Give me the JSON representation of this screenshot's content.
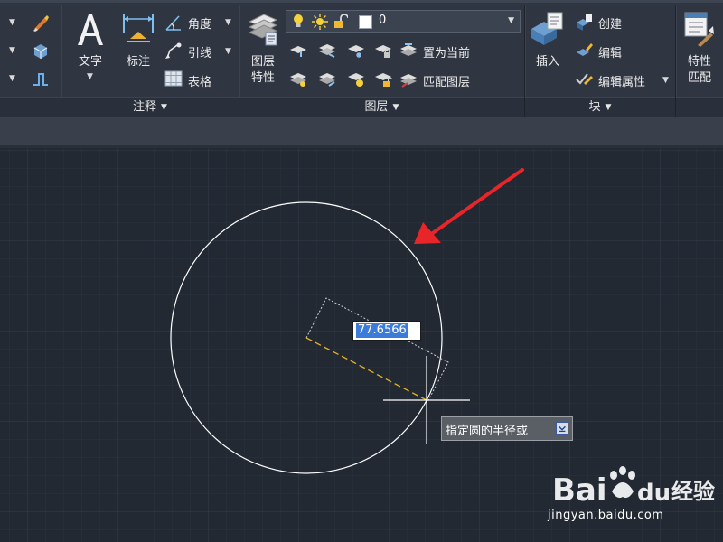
{
  "ribbon": {
    "annotation": {
      "text_label": "文字",
      "dimension_label": "标注",
      "angular_label": "角度",
      "leader_label": "引线",
      "table_label": "表格",
      "panel_title": "注释"
    },
    "layers": {
      "properties_label_line1": "图层",
      "properties_label_line2": "特性",
      "current_layer": "0",
      "set_current_label": "置为当前",
      "match_layer_label": "匹配图层",
      "panel_title": "图层"
    },
    "block": {
      "insert_label": "插入",
      "create_label": "创建",
      "edit_label": "编辑",
      "edit_attributes_label": "编辑属性",
      "panel_title": "块"
    },
    "properties": {
      "match_label_line1": "特性",
      "match_label_line2": "匹配"
    }
  },
  "drawing": {
    "dimension_value": "77.6566",
    "prompt_text": "指定圆的半径或"
  },
  "watermark": {
    "brand": "Bai",
    "brand_tail": "du",
    "product": "经验",
    "url": "jingyan.baidu.com"
  },
  "colors": {
    "canvas_bg": "#222933",
    "ribbon_bg": "#2f3541",
    "circle": "#ffffff",
    "radius_line": "#e6b422",
    "arrow": "#e8262a",
    "input_highlight": "#3b7bd9"
  }
}
